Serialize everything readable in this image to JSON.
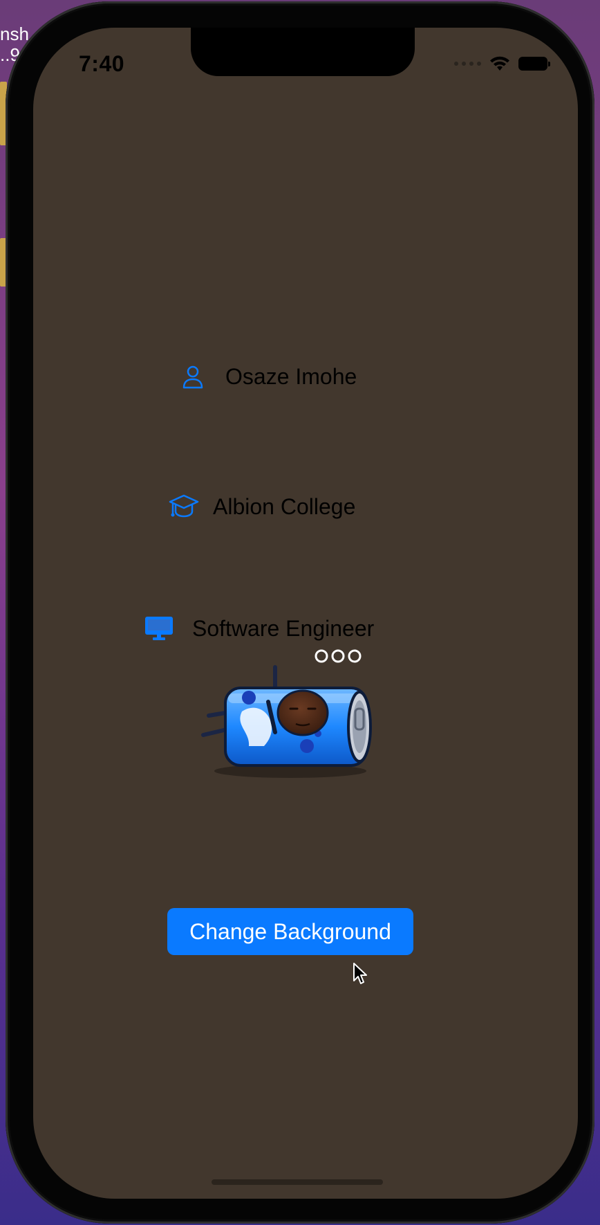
{
  "desktop": {
    "label_line1": "nsh",
    "label_line2": "..9"
  },
  "status_bar": {
    "time": "7:40"
  },
  "profile": {
    "name": "Osaze Imohe",
    "school": "Albion College",
    "role": "Software Engineer"
  },
  "icons": {
    "name": "person-icon",
    "school": "graduation-cap-icon",
    "role": "desktop-computer-icon"
  },
  "button": {
    "label": "Change Background"
  },
  "colors": {
    "background": "#42372d",
    "accent": "#0a7aff",
    "text": "#000000"
  }
}
